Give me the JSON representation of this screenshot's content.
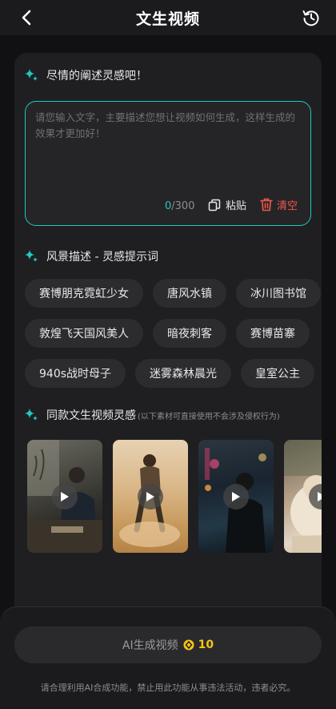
{
  "header": {
    "title": "文生视频"
  },
  "prompt": {
    "heading": "尽情的阐述灵感吧！",
    "placeholder": "请您输入文字，主要描述您想让视频如何生成，这样生成的效果才更加好！",
    "count_current": "0",
    "count_max": "/300",
    "paste_label": "粘贴",
    "clear_label": "清空"
  },
  "scenery": {
    "heading": "风景描述 - 灵感提示词",
    "rows": [
      [
        "赛博朋克霓虹少女",
        "唐风水镇",
        "冰川图书馆"
      ],
      [
        "敦煌飞天国风美人",
        "暗夜刺客",
        "赛博苗寨"
      ],
      [
        "940s战时母子",
        "迷雾森林晨光",
        "皇室公主"
      ]
    ]
  },
  "inspiration": {
    "heading": "同款文生视频灵感",
    "note": "(以下素材可直接使用不会涉及侵权行为)",
    "videos": [
      "video-1",
      "video-2",
      "video-3",
      "video-4"
    ]
  },
  "footer": {
    "generate_label": "AI生成视频",
    "cost": "10",
    "disclaimer": "请合理利用AI合成功能，禁止用此功能从事违法活动，违者必究。"
  },
  "colors": {
    "accent": "#1fc9c0",
    "danger": "#f0584a",
    "coin": "#f5c517"
  }
}
